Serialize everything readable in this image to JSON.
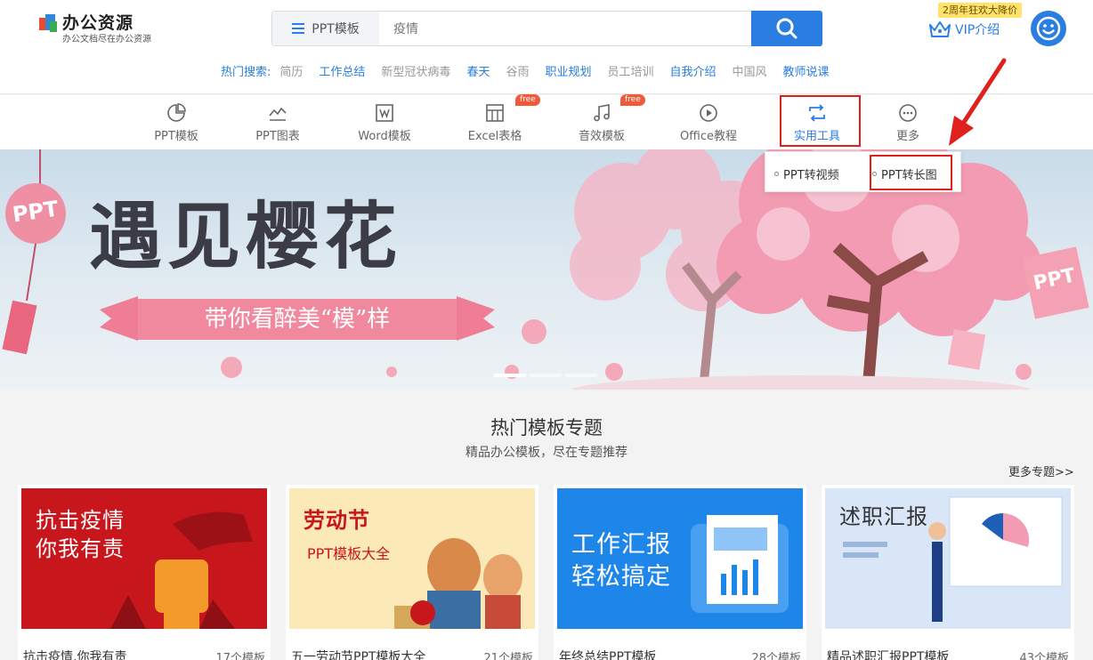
{
  "logo": {
    "title": "办公资源",
    "slogan": "办公文档尽在办公资源"
  },
  "search": {
    "category": "PPT模板",
    "value": "疫情"
  },
  "hot_search": {
    "label": "热门搜索:",
    "keywords": [
      {
        "text": "简历",
        "hl": false
      },
      {
        "text": "工作总结",
        "hl": true
      },
      {
        "text": "新型冠状病毒",
        "hl": false
      },
      {
        "text": "春天",
        "hl": true
      },
      {
        "text": "谷雨",
        "hl": false
      },
      {
        "text": "职业规划",
        "hl": true
      },
      {
        "text": "员工培训",
        "hl": false
      },
      {
        "text": "自我介绍",
        "hl": true
      },
      {
        "text": "中国风",
        "hl": false
      },
      {
        "text": "教师说课",
        "hl": true
      }
    ]
  },
  "vip": {
    "badge": "2周年狂欢大降价",
    "label": "VIP介绍"
  },
  "nav": {
    "items": [
      {
        "label": "PPT模板",
        "icon": "pie-chart-icon"
      },
      {
        "label": "PPT图表",
        "icon": "line-chart-icon"
      },
      {
        "label": "Word模板",
        "icon": "word-icon"
      },
      {
        "label": "Excel表格",
        "icon": "table-icon",
        "free": "free"
      },
      {
        "label": "音效模板",
        "icon": "music-note-icon",
        "free": "free"
      },
      {
        "label": "Office教程",
        "icon": "play-circle-icon"
      },
      {
        "label": "实用工具",
        "icon": "convert-icon"
      },
      {
        "label": "更多",
        "icon": "more-icon"
      }
    ]
  },
  "dropdown": {
    "items": [
      "PPT转视频",
      "PPT转长图"
    ]
  },
  "banner": {
    "title": "遇见樱花",
    "ribbon": "带你看醉美“模”样",
    "tag": "PPT"
  },
  "section": {
    "title": "热门模板专题",
    "subtitle": "精品办公模板，尽在专题推荐",
    "more": "更多专题>>"
  },
  "cards": [
    {
      "thumb_text": "抗击疫情\n你我有责",
      "name": "抗击疫情,你我有责",
      "count": "17个模板",
      "bg": "#c8161d"
    },
    {
      "thumb_text": "劳动节",
      "thumb_sub": "PPT模板大全",
      "name": "五一劳动节PPT模板大全",
      "count": "21个模板",
      "bg": "#fbe9b7"
    },
    {
      "thumb_text": "工作汇报\n轻松搞定",
      "name": "年终总结PPT模板",
      "count": "28个模板",
      "bg": "#1e86e8"
    },
    {
      "thumb_text": "述职汇报",
      "name": "精品述职汇报PPT模板",
      "count": "43个模板",
      "bg": "#d8e6f7"
    }
  ],
  "colors": {
    "accent": "#2a7de1",
    "highlight": "#e0201c"
  }
}
